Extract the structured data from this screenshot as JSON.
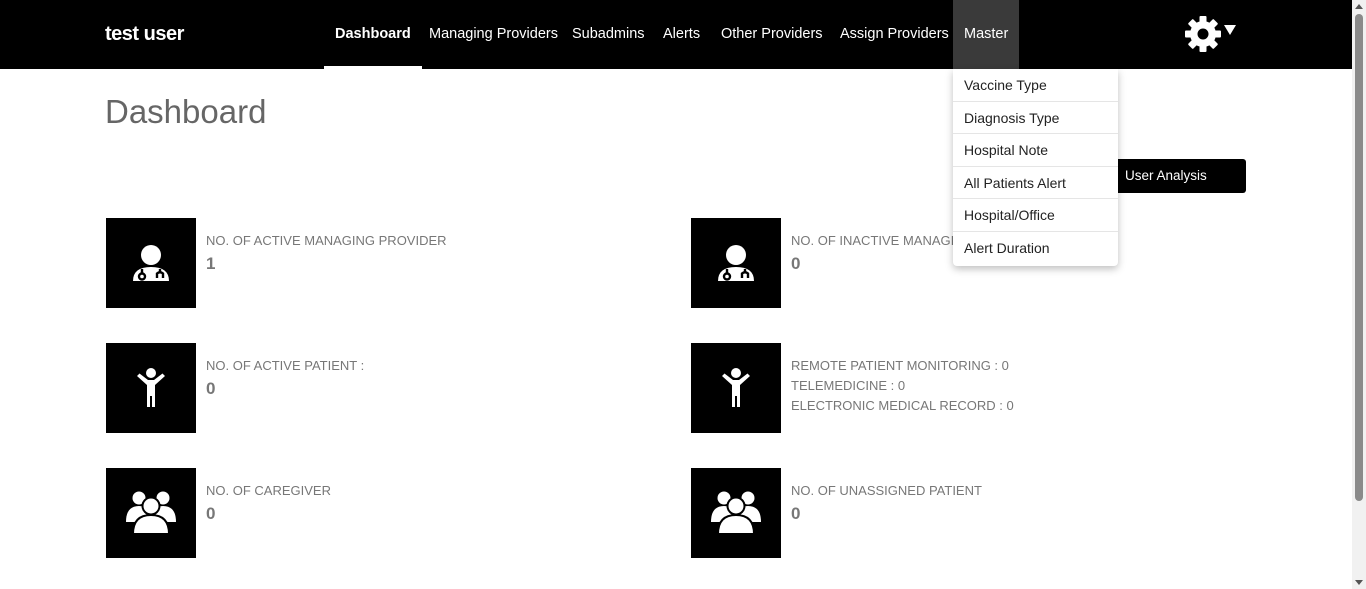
{
  "brand": "test user",
  "nav": {
    "items": [
      {
        "label": "Dashboard",
        "active": true
      },
      {
        "label": "Managing Providers"
      },
      {
        "label": "Subadmins"
      },
      {
        "label": "Alerts"
      },
      {
        "label": "Other Providers"
      },
      {
        "label": "Assign Providers"
      },
      {
        "label": "Master",
        "open": true
      }
    ],
    "settings_icon": "gear-icon"
  },
  "master_menu": [
    "Vaccine Type",
    "Diagnosis Type",
    "Hospital Note",
    "All Patients Alert",
    "Hospital/Office",
    "Alert Duration"
  ],
  "page": {
    "title": "Dashboard",
    "user_analysis_button": "User Analysis"
  },
  "cards": {
    "active_managing": {
      "label": "NO. OF ACTIVE MANAGING PROVIDER",
      "value": "1",
      "icon": "doctor-icon"
    },
    "inactive_managing": {
      "label": "NO. OF INACTIVE MANAGING PROVIDER",
      "value": "0",
      "icon": "doctor-icon"
    },
    "active_patient": {
      "label": "NO. OF ACTIVE PATIENT :",
      "value": "0",
      "icon": "child-icon"
    },
    "programs": {
      "icon": "child-icon",
      "lines": [
        "REMOTE PATIENT MONITORING : 0",
        "TELEMEDICINE : 0",
        "ELECTRONIC MEDICAL RECORD : 0"
      ]
    },
    "caregiver": {
      "label": "NO. OF CAREGIVER",
      "value": "0",
      "icon": "group-icon"
    },
    "unassigned": {
      "label": "NO. OF UNASSIGNED PATIENT",
      "value": "0",
      "icon": "group-icon"
    }
  },
  "colors": {
    "nav_bg": "#000000",
    "master_bg": "#3a3a3a",
    "tile_bg": "#000000",
    "text_muted": "#777777"
  }
}
